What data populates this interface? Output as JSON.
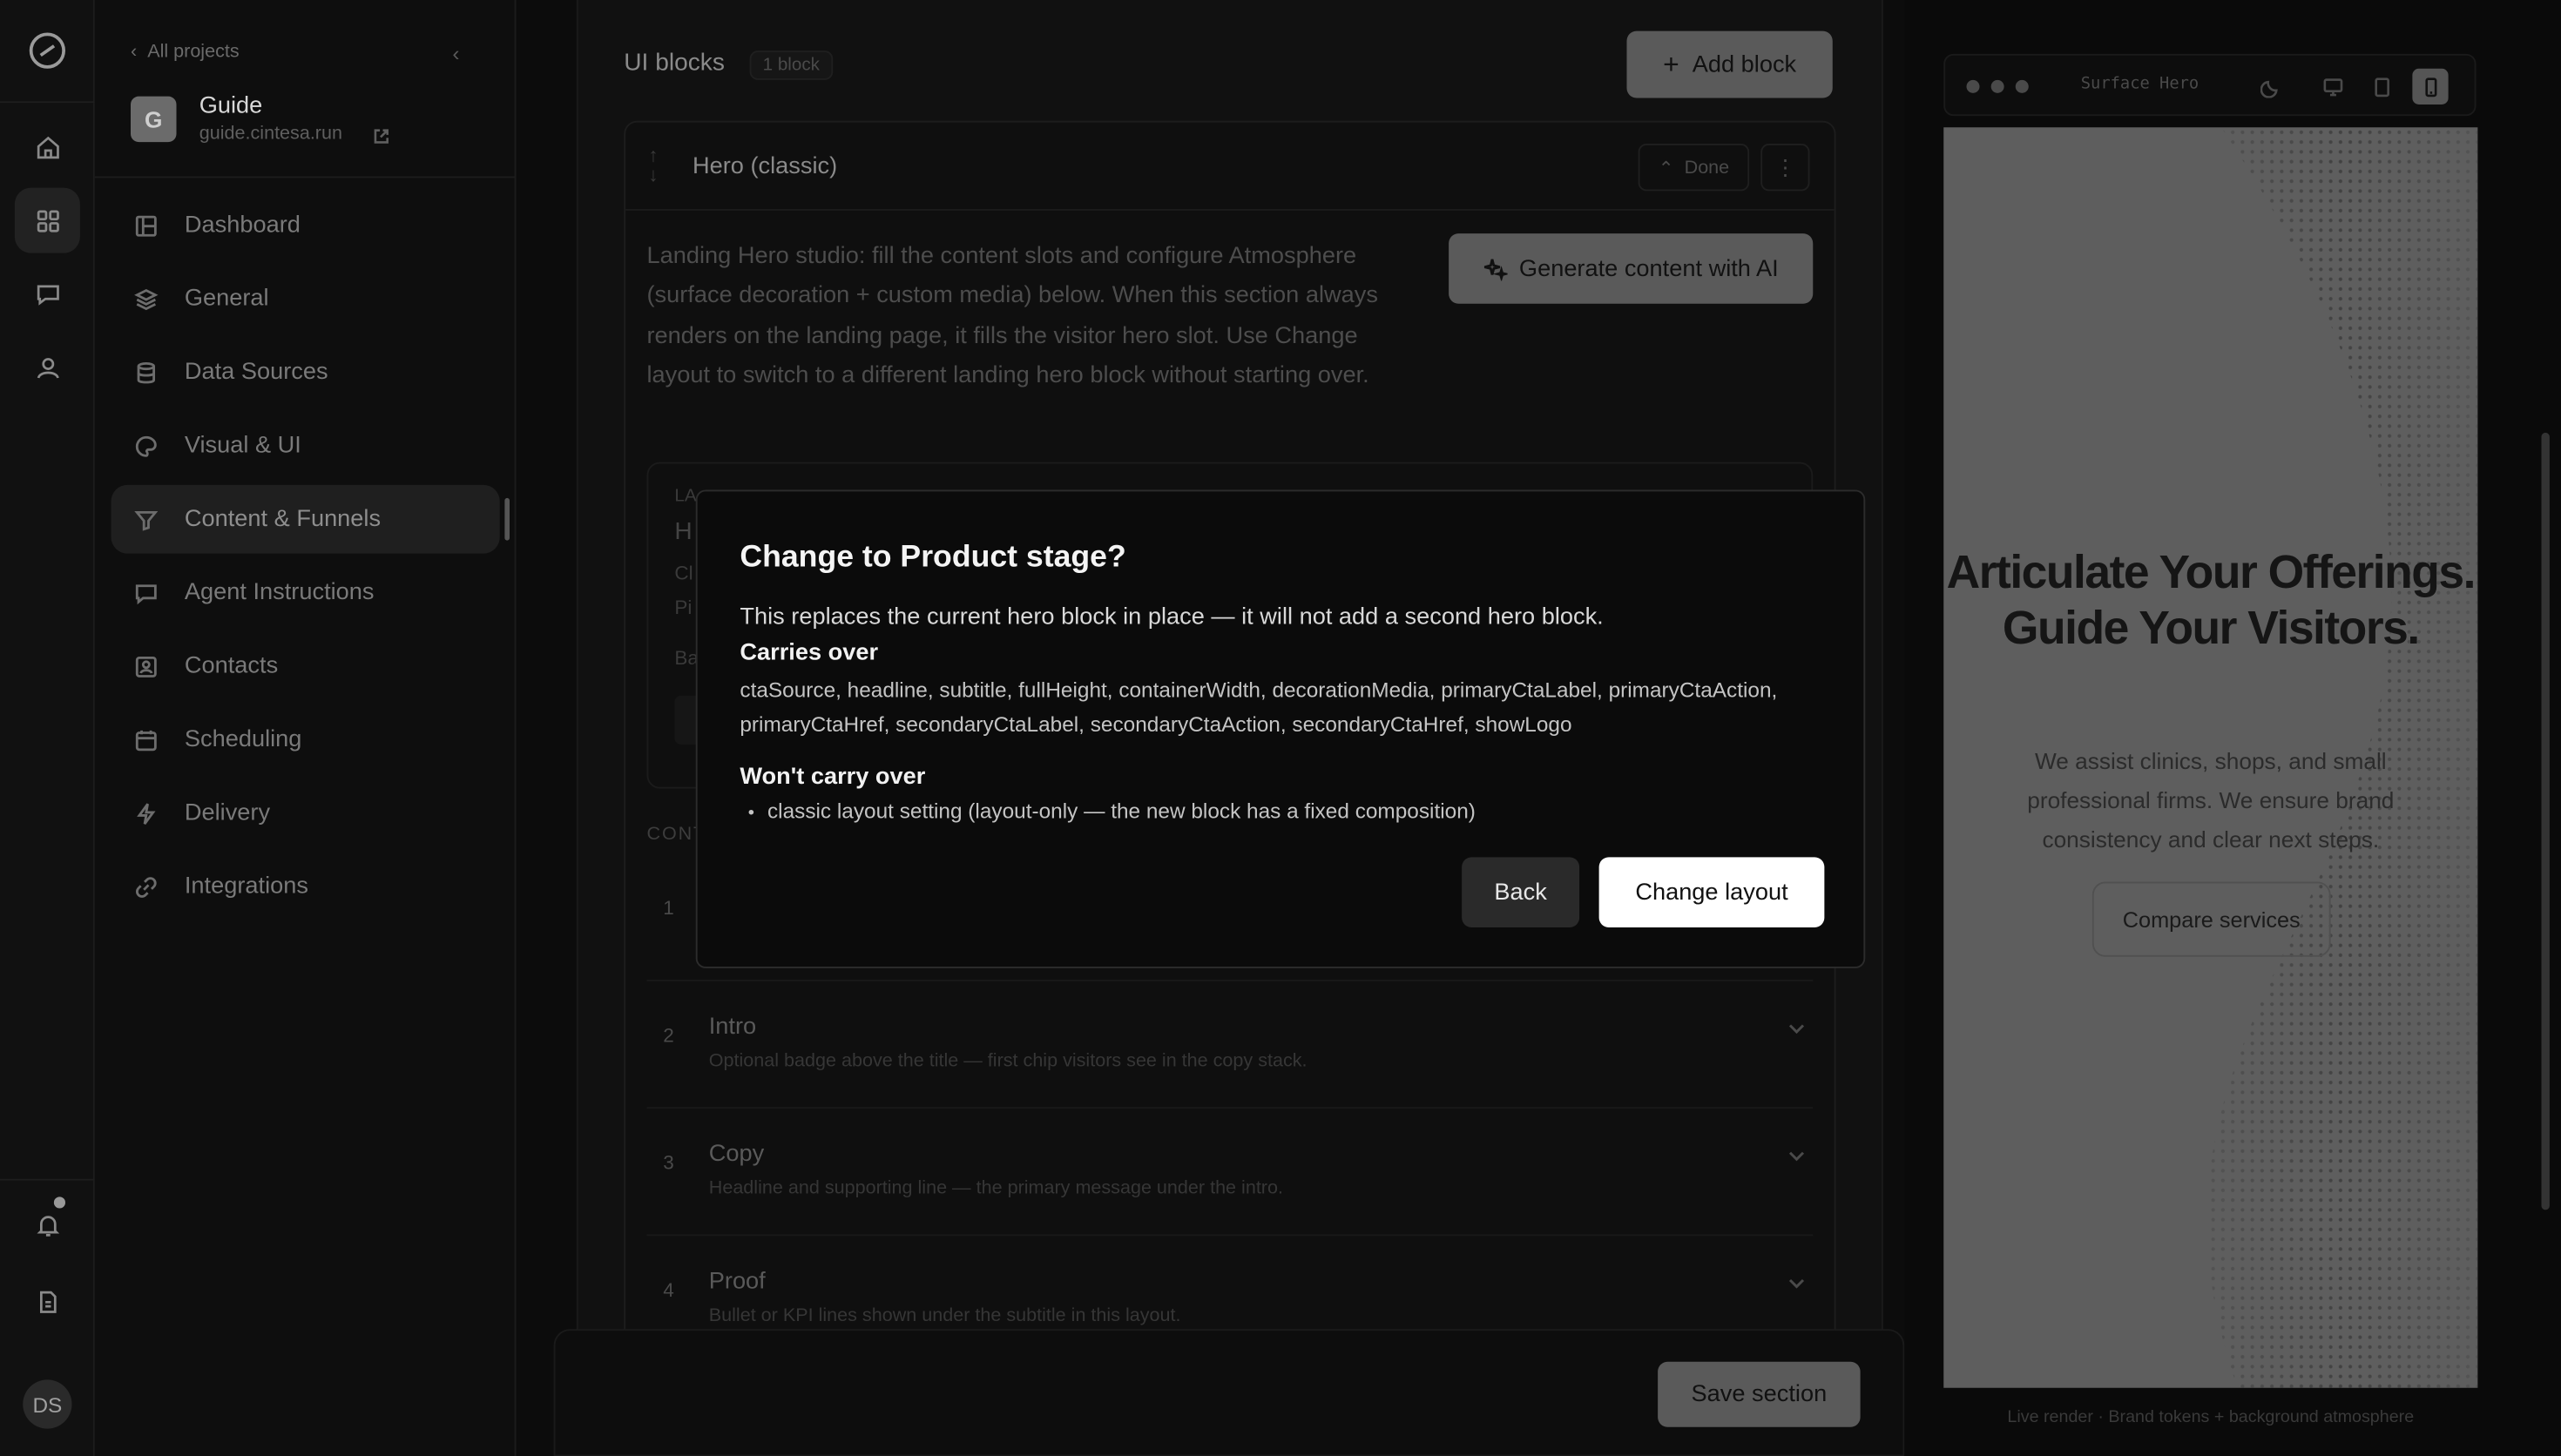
{
  "rail": {
    "icons": [
      "logo-icon",
      "home-icon",
      "grid-icon",
      "chat-icon",
      "user-icon",
      "bell-icon",
      "document-icon"
    ],
    "avatar_initials": "DS"
  },
  "sidebar": {
    "back_label": "All projects",
    "project_name": "Guide",
    "project_url": "guide.cintesa.run",
    "items": [
      {
        "label": "Dashboard",
        "icon": "dashboard-icon"
      },
      {
        "label": "General",
        "icon": "layers-icon"
      },
      {
        "label": "Data Sources",
        "icon": "database-icon"
      },
      {
        "label": "Visual & UI",
        "icon": "palette-icon"
      },
      {
        "label": "Content & Funnels",
        "icon": "filter-icon",
        "active": true
      },
      {
        "label": "Agent Instructions",
        "icon": "message-icon"
      },
      {
        "label": "Contacts",
        "icon": "contacts-icon"
      },
      {
        "label": "Scheduling",
        "icon": "calendar-icon"
      },
      {
        "label": "Delivery",
        "icon": "bolt-icon"
      },
      {
        "label": "Integrations",
        "icon": "link-icon"
      }
    ]
  },
  "main": {
    "title": "UI blocks",
    "count_badge": "1 block",
    "add_block_label": "Add block",
    "card": {
      "title": "Hero (classic)",
      "done_label": "Done",
      "description": "Landing Hero studio: fill the content slots and configure Atmosphere (surface decoration + custom media) below. When this section always renders on the landing page, it fills the visitor hero slot. Use Change layout to switch to a different landing hero block without starting over.",
      "generate_label": "Generate content with AI",
      "content_label": "CONT",
      "slots": [
        {
          "num": "1",
          "title": "",
          "subtitle": ""
        },
        {
          "num": "2",
          "title": "Intro",
          "subtitle": "Optional badge above the title — first chip visitors see in the copy stack."
        },
        {
          "num": "3",
          "title": "Copy",
          "subtitle": "Headline and supporting line — the primary message under the intro."
        },
        {
          "num": "4",
          "title": "Proof",
          "subtitle": "Bullet or KPI lines shown under the subtitle in this layout."
        }
      ]
    },
    "save_label": "Save section"
  },
  "preview": {
    "url_label": "Surface Hero",
    "hero_title": "Articulate Your Offerings. Guide Your Visitors.",
    "hero_subtitle": "We assist clinics, shops, and small professional firms. We ensure brand consistency and clear next steps.",
    "cta_label": "Compare services",
    "caption": "Live render · Brand tokens + background atmosphere"
  },
  "modal": {
    "title": "Change to Product stage?",
    "description": "This replaces the current hero block in place — it will not add a second hero block.",
    "carries_heading": "Carries over",
    "carries_list": "ctaSource, headline, subtitle, fullHeight, containerWidth, decorationMedia, primaryCtaLabel, primaryCtaAction, primaryCtaHref, secondaryCtaLabel, secondaryCtaAction, secondaryCtaHref, showLogo",
    "wont_heading": "Won't carry over",
    "wont_items": [
      "classic layout setting (layout-only — the new block has a fixed composition)"
    ],
    "back_label": "Back",
    "confirm_label": "Change layout"
  }
}
